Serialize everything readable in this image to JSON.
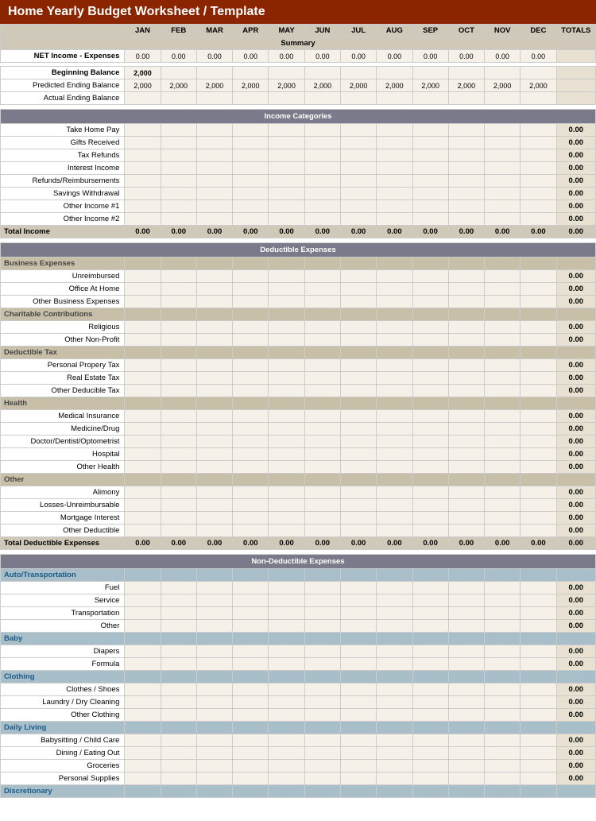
{
  "title": "Home Yearly Budget Worksheet / Template",
  "columns": {
    "months": [
      "JAN",
      "FEB",
      "MAR",
      "APR",
      "MAY",
      "JUN",
      "JUL",
      "AUG",
      "SEP",
      "OCT",
      "NOV",
      "DEC"
    ],
    "totals": "TOTALS"
  },
  "summary": {
    "label": "Summary",
    "net_income_label": "NET Income - Expenses",
    "net_values": [
      "0.00",
      "0.00",
      "0.00",
      "0.00",
      "0.00",
      "0.00",
      "0.00",
      "0.00",
      "0.00",
      "0.00",
      "0.00",
      "0.00"
    ],
    "beginning_balance_label": "Beginning Balance",
    "beginning_balance_value": "2,000",
    "predicted_label": "Predicted Ending Balance",
    "predicted_values": [
      "2,000",
      "2,000",
      "2,000",
      "2,000",
      "2,000",
      "2,000",
      "2,000",
      "2,000",
      "2,000",
      "2,000",
      "2,000",
      "2,000"
    ],
    "actual_label": "Actual Ending Balance"
  },
  "income": {
    "section_label": "Income Categories",
    "rows": [
      {
        "label": "Take Home Pay"
      },
      {
        "label": "Gifts Received"
      },
      {
        "label": "Tax Refunds"
      },
      {
        "label": "Interest Income"
      },
      {
        "label": "Refunds/Reimbursements"
      },
      {
        "label": "Savings Withdrawal"
      },
      {
        "label": "Other Income #1"
      },
      {
        "label": "Other Income #2"
      }
    ],
    "total_label": "Total Income",
    "total_values": [
      "0.00",
      "0.00",
      "0.00",
      "0.00",
      "0.00",
      "0.00",
      "0.00",
      "0.00",
      "0.00",
      "0.00",
      "0.00",
      "0.00"
    ],
    "total_right": "0.00"
  },
  "deductible": {
    "section_label": "Deductible Expenses",
    "subsections": [
      {
        "header": "Business Expenses",
        "rows": [
          {
            "label": "Unreimbursed"
          },
          {
            "label": "Office At Home"
          },
          {
            "label": "Other Business Expenses"
          }
        ]
      },
      {
        "header": "Charitable Contributions",
        "rows": [
          {
            "label": "Religious"
          },
          {
            "label": "Other Non-Profit"
          }
        ]
      },
      {
        "header": "Deductible Tax",
        "rows": [
          {
            "label": "Personal Propery Tax"
          },
          {
            "label": "Real Estate Tax"
          },
          {
            "label": "Other Deducible Tax"
          }
        ]
      },
      {
        "header": "Health",
        "rows": [
          {
            "label": "Medical Insurance"
          },
          {
            "label": "Medicine/Drug"
          },
          {
            "label": "Doctor/Dentist/Optometrist"
          },
          {
            "label": "Hospital"
          },
          {
            "label": "Other Health"
          }
        ]
      },
      {
        "header": "Other",
        "rows": [
          {
            "label": "Alimony"
          },
          {
            "label": "Losses-Unreimbursable"
          },
          {
            "label": "Mortgage Interest"
          },
          {
            "label": "Other Deductible"
          }
        ]
      }
    ],
    "total_label": "Total Deductible Expenses",
    "total_values": [
      "0.00",
      "0.00",
      "0.00",
      "0.00",
      "0.00",
      "0.00",
      "0.00",
      "0.00",
      "0.00",
      "0.00",
      "0.00",
      "0.00"
    ],
    "total_right": "0.00"
  },
  "nondeductible": {
    "section_label": "Non-Deductible Expenses",
    "subsections": [
      {
        "header": "Auto/Transportation",
        "rows": [
          {
            "label": "Fuel"
          },
          {
            "label": "Service"
          },
          {
            "label": "Transportation"
          },
          {
            "label": "Other"
          }
        ]
      },
      {
        "header": "Baby",
        "rows": [
          {
            "label": "Diapers"
          },
          {
            "label": "Formula"
          }
        ]
      },
      {
        "header": "Clothing",
        "rows": [
          {
            "label": "Clothes / Shoes"
          },
          {
            "label": "Laundry / Dry Cleaning"
          },
          {
            "label": "Other Clothing"
          }
        ]
      },
      {
        "header": "Daily Living",
        "rows": [
          {
            "label": "Babysitting / Child Care"
          },
          {
            "label": "Dining / Eating Out"
          },
          {
            "label": "Groceries"
          },
          {
            "label": "Personal Supplies"
          }
        ]
      },
      {
        "header": "Discretionary",
        "rows": []
      }
    ]
  }
}
